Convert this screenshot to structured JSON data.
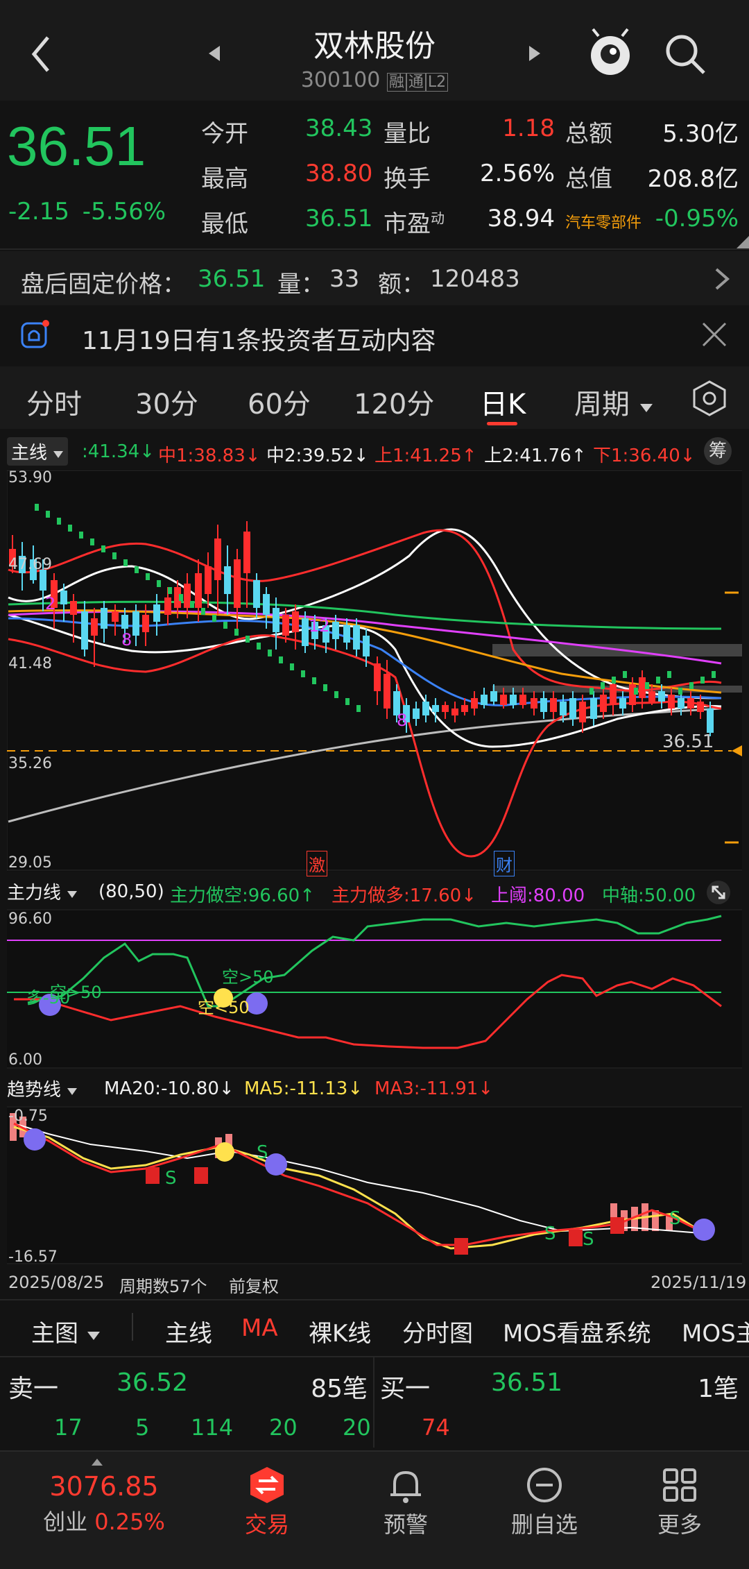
{
  "header": {
    "stock_name": "双林股份",
    "stock_code": "300100",
    "tags": [
      "融",
      "通",
      "L2"
    ]
  },
  "quote": {
    "price": "36.51",
    "change": "-2.15",
    "change_pct": "-5.56%",
    "fields": [
      {
        "label": "今开",
        "value": "38.43",
        "color": "#22c55e"
      },
      {
        "label": "最高",
        "value": "38.80",
        "color": "#ff3b30"
      },
      {
        "label": "最低",
        "value": "36.51",
        "color": "#22c55e"
      },
      {
        "label": "量比",
        "value": "1.18",
        "color": "#ff3b30"
      },
      {
        "label": "换手",
        "value": "2.56%",
        "color": "#f0f0f0"
      },
      {
        "label": "市盈",
        "label_sup": "动",
        "value": "38.94",
        "color": "#f0f0f0"
      },
      {
        "label": "总额",
        "value": "5.30亿",
        "color": "#f0f0f0"
      },
      {
        "label": "总值",
        "value": "208.8亿",
        "color": "#f0f0f0"
      },
      {
        "label": "汽车零部件",
        "value": "-0.95%",
        "color": "#22c55e"
      }
    ]
  },
  "after_hours": {
    "label": "盘后固定价格：",
    "price": "36.51",
    "vol_label": "量：",
    "vol": "33",
    "amt_label": "额：",
    "amt": "120483"
  },
  "notice": {
    "text": "11月19日有1条投资者互动内容"
  },
  "period_tabs": {
    "items": [
      "分时",
      "30分",
      "60分",
      "120分",
      "日K",
      "周期"
    ],
    "active": "日K"
  },
  "main_indicator": {
    "name": "主线",
    "values": [
      {
        "text": ":41.34↓",
        "color": "#22c55e"
      },
      {
        "text": "中1:38.83↓",
        "color": "#ff3b30"
      },
      {
        "text": "中2:39.52↓",
        "color": "#f0f0f0"
      },
      {
        "text": "上1:41.25↑",
        "color": "#ff3b30"
      },
      {
        "text": "上2:41.76↑",
        "color": "#f0f0f0"
      },
      {
        "text": "下1:36.40↓",
        "color": "#ff3b30"
      }
    ],
    "chip_label": "筹",
    "y_labels": [
      "53.90",
      "47.69",
      "41.48",
      "35.26",
      "29.05"
    ],
    "last_price_tag": "36.51",
    "event_tags": [
      "激",
      "财"
    ],
    "bar_markers": [
      "2",
      "8",
      "12",
      "8"
    ]
  },
  "zhuli": {
    "name": "主力线",
    "params": "(80,50)",
    "values": [
      {
        "text": "主力做空:96.60↑",
        "color": "#22c55e"
      },
      {
        "text": "主力做多:17.60↓",
        "color": "#ff3b30"
      },
      {
        "text": "上阈:80.00",
        "color": "#e040fb"
      },
      {
        "text": "中轴:50.00",
        "color": "#22c55e"
      }
    ],
    "y_top": "96.60",
    "y_bottom": "6.00",
    "annotations": [
      "多-50",
      "空>50",
      "空>50",
      "空<50"
    ]
  },
  "trend": {
    "name": "趋势线",
    "values": [
      {
        "text": "MA20:-10.80↓",
        "color": "#f0f0f0"
      },
      {
        "text": "MA5:-11.13↓",
        "color": "#ffe14d"
      },
      {
        "text": "MA3:-11.91↓",
        "color": "#ff3b30"
      }
    ],
    "y_top": "-0.75",
    "y_bottom": "-16.57"
  },
  "date_bar": {
    "start": "2025/08/25",
    "period_count": "周期数57个",
    "adjust": "前复权",
    "end": "2025/11/19"
  },
  "chart_toolbar": {
    "main_select": "主图",
    "items": [
      "主线",
      "MA",
      "裸K线",
      "分时图",
      "MOS看盘系统",
      "MOS主"
    ]
  },
  "order_book": {
    "sell1": {
      "label": "卖一",
      "price": "36.52",
      "count": "85笔"
    },
    "buy1": {
      "label": "买一",
      "price": "36.51",
      "count": "1笔"
    },
    "sell_queue": [
      "17",
      "5",
      "114",
      "20",
      "20"
    ],
    "buy_queue": [
      "74"
    ]
  },
  "bottom_nav": {
    "index_value": "3076.85",
    "index_name": "创业",
    "index_change": "0.25%",
    "items": [
      {
        "label": "交易",
        "icon": "trade-icon"
      },
      {
        "label": "预警",
        "icon": "bell-icon"
      },
      {
        "label": "删自选",
        "icon": "remove-watch-icon"
      },
      {
        "label": "更多",
        "icon": "grid-icon"
      }
    ]
  }
}
